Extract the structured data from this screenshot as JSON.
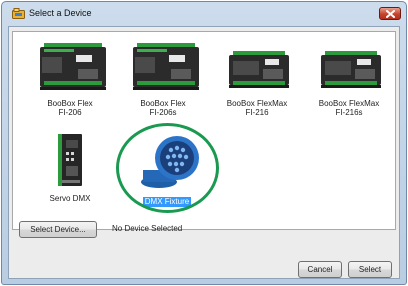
{
  "window": {
    "title": "Select a Device"
  },
  "devices": [
    {
      "id": "fi206",
      "label_line1": "BooBox Flex",
      "label_line2": "FI-206",
      "selected": false
    },
    {
      "id": "fi206s",
      "label_line1": "BooBox Flex",
      "label_line2": "FI-206s",
      "selected": false
    },
    {
      "id": "fi216",
      "label_line1": "BooBox FlexMax",
      "label_line2": "FI-216",
      "selected": false
    },
    {
      "id": "fi216s",
      "label_line1": "BooBox FlexMax",
      "label_line2": "FI-216s",
      "selected": false
    },
    {
      "id": "servo",
      "label_line1": "Servo DMX",
      "label_line2": "",
      "selected": false
    },
    {
      "id": "dmx",
      "label_line1": "DMX Fixture",
      "label_line2": "",
      "selected": true
    }
  ],
  "controls": {
    "select_device_label": "Select Device...",
    "status_text": "No Device Selected",
    "cancel_label": "Cancel",
    "select_label": "Select"
  },
  "colors": {
    "selection_ring": "#1a9a50",
    "selection_highlight": "#3399ff",
    "close_button": "#c5442d"
  }
}
